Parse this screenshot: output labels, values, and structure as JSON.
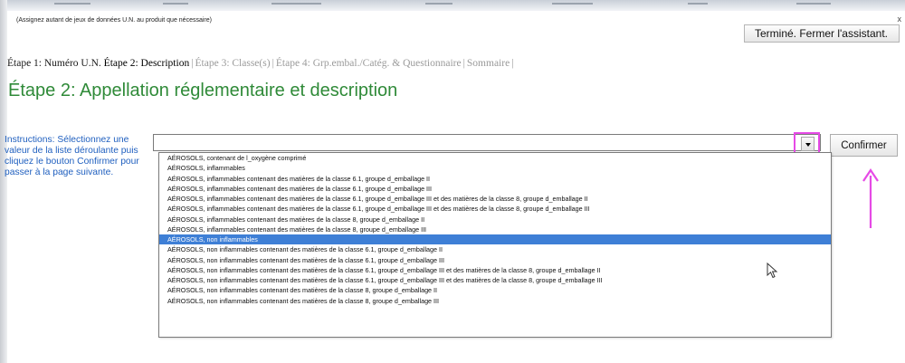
{
  "window": {
    "hint": "(Assignez autant de jeux de données U.N. au produit que nécessaire)",
    "close_label": "x"
  },
  "toolbar": {
    "finish_label": "Terminé. Fermer l'assistant."
  },
  "steps": [
    {
      "label": "Étape 1: Numéro U.N.",
      "state": "done"
    },
    {
      "label": "Étape 2: Description",
      "state": "active"
    },
    {
      "label": "Étape 3: Classe(s)",
      "state": "disabled"
    },
    {
      "label": "Étape 4: Grp.embal./Catég. & Questionnaire",
      "state": "disabled"
    },
    {
      "label": "Sommaire",
      "state": "disabled"
    }
  ],
  "page": {
    "title": "Étape 2: Appellation réglementaire et description"
  },
  "instructions": "Instructions: Sélectionnez une valeur de la liste déroulante puis cliquez le bouton Confirmer pour passer à la page suivante.",
  "combo": {
    "value": "",
    "confirm_label": "Confirmer"
  },
  "dropdown": {
    "selected_index": 8,
    "options": [
      "AÉROSOLS, contenant de l_oxygène comprimé",
      "AÉROSOLS, inflammables",
      "AÉROSOLS, inflammables contenant des matières de la classe 6.1, groupe d_emballage II",
      "AÉROSOLS, inflammables contenant des matières de la classe 6.1, groupe d_emballage III",
      "AÉROSOLS, inflammables contenant des matières de la classe 6.1, groupe d_emballage III et des matières de la classe 8, groupe d_emballage II",
      "AÉROSOLS, inflammables contenant des matières de la classe 6.1, groupe d_emballage III et des matières de la classe 8, groupe d_emballage III",
      "AÉROSOLS, inflammables contenant des matières de la classe 8, groupe d_emballage II",
      "AÉROSOLS, inflammables contenant des matières de la classe 8, groupe d_emballage III",
      "AÉROSOLS, non inflammables",
      "AÉROSOLS, non inflammables contenant des matières de la classe 6.1, groupe d_emballage II",
      "AÉROSOLS, non inflammables contenant des matières de la classe 6.1, groupe d_emballage III",
      "AÉROSOLS, non inflammables contenant des matières de la classe 6.1, groupe d_emballage III et des matières de la classe 8, groupe d_emballage II",
      "AÉROSOLS, non inflammables contenant des matières de la classe 6.1, groupe d_emballage III et des matières de la classe 8, groupe d_emballage III",
      "AÉROSOLS, non inflammables contenant des matières de la classe 8, groupe d_emballage II",
      "AÉROSOLS, non inflammables contenant des matières de la classe 8, groupe d_emballage III"
    ]
  },
  "colors": {
    "title": "#2f8a38",
    "instructions": "#1f5fbf",
    "selection": "#3e7fd6",
    "highlight": "#e64ae6"
  },
  "icons": {
    "dropdown": "chevron-down-icon",
    "pointer": "mouse-pointer-icon",
    "annotation": "arrow-up-icon"
  }
}
